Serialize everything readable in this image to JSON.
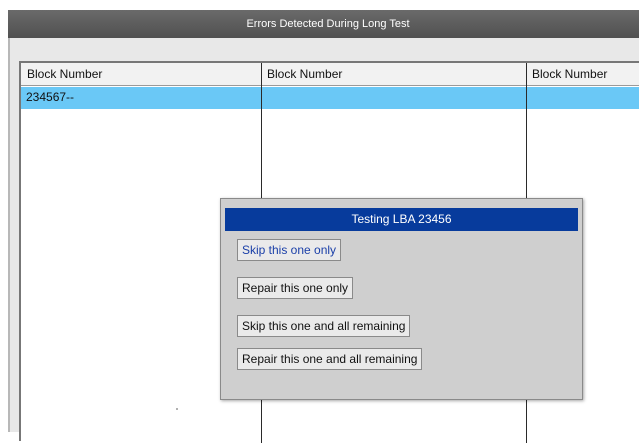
{
  "window": {
    "title": "Errors Detected During Long Test"
  },
  "table": {
    "columns": [
      "Block Number",
      "Block Number",
      "Block Number"
    ],
    "rows": [
      [
        "234567--",
        "",
        ""
      ]
    ],
    "selected_row_color": "#6ac8f6"
  },
  "dialog": {
    "title": "Testing LBA 23456",
    "title_color": "#073b9c",
    "buttons": [
      "Skip this one only",
      "Repair this one only",
      "Skip this one and all remaining",
      "Repair this one and all remaining"
    ]
  }
}
